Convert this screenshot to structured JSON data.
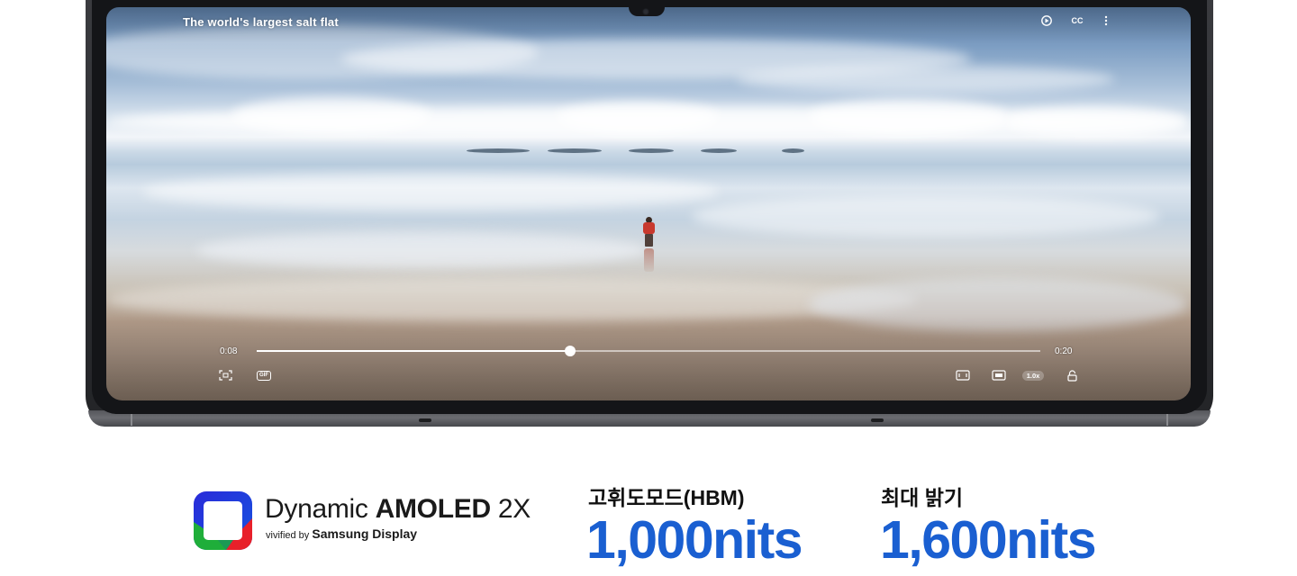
{
  "video_player": {
    "title": "The world's largest salt flat",
    "top_controls": [
      {
        "icon": "rotate-screen-icon"
      },
      {
        "icon": "captions-icon",
        "label": "CC"
      },
      {
        "icon": "more-options-icon"
      }
    ],
    "current_time": "0:08",
    "duration": "0:20",
    "progress": 0.4,
    "bottom_left_controls": [
      {
        "icon": "screen-capture-icon"
      },
      {
        "icon": "gif-icon",
        "label": "GIF"
      }
    ],
    "bottom_right_controls": [
      {
        "icon": "aspect-ratio-icon"
      },
      {
        "icon": "pop-up-play-icon"
      },
      {
        "icon": "playback-speed-icon",
        "label": "1.0x"
      },
      {
        "icon": "lock-icon"
      }
    ]
  },
  "branding": {
    "line1_light": "Dynamic ",
    "line1_bold": "AMOLED",
    "line1_suffix": " 2X",
    "line2_prefix": "vivified by ",
    "line2_bold": "Samsung Display",
    "logo_colors": [
      "#1f3fd6",
      "#1fae3a",
      "#e8202a"
    ]
  },
  "specs": [
    {
      "label": "고휘도모드(HBM)",
      "value": "1,000nits"
    },
    {
      "label": "최대 밝기",
      "value": "1,600nits"
    }
  ],
  "colors": {
    "accent_blue": "#1a5fd1",
    "bezel": "#2b2c30"
  }
}
